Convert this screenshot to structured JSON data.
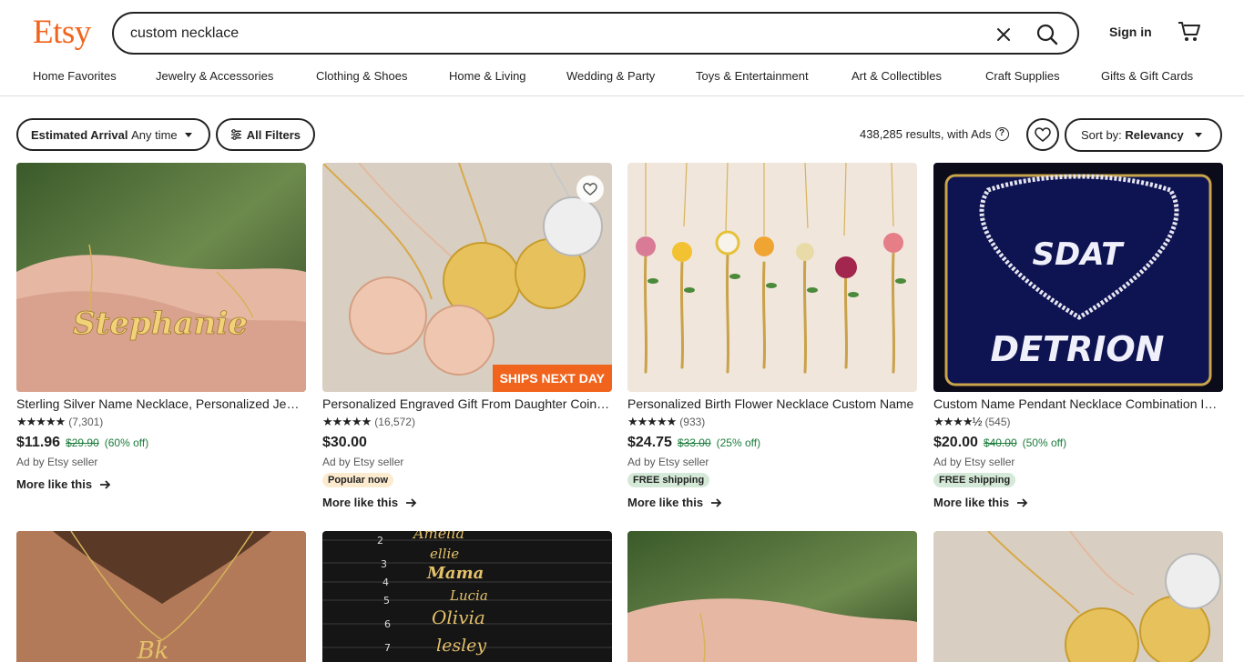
{
  "header": {
    "logo": "Etsy",
    "search_value": "custom necklace",
    "sign_in": "Sign in"
  },
  "nav": [
    "Home Favorites",
    "Jewelry & Accessories",
    "Clothing & Shoes",
    "Home & Living",
    "Wedding & Party",
    "Toys & Entertainment",
    "Art & Collectibles",
    "Craft Supplies",
    "Gifts & Gift Cards"
  ],
  "filters": {
    "arrival_label": "Estimated Arrival",
    "arrival_value": "Any time",
    "all_filters": "All Filters",
    "results": "438,285 results, with Ads",
    "sort_label": "Sort by:",
    "sort_value": "Relevancy"
  },
  "products": [
    {
      "title": "Sterling Silver Name Necklace, Personalized Jewelry",
      "reviews": "(7,301)",
      "price": "$11.96",
      "original": "$29.90",
      "discount": "(60% off)",
      "ad": "Ad by Etsy seller",
      "more": "More like this",
      "image": "Stephanie"
    },
    {
      "title": "Personalized Engraved Gift From Daughter Coin Necklace",
      "reviews": "(16,572)",
      "price": "$30.00",
      "ad": "Ad by Etsy seller",
      "badge": "Popular now",
      "more": "More like this",
      "ships_tag": "SHIPS NEXT DAY"
    },
    {
      "title": "Personalized Birth Flower Necklace Custom Name",
      "reviews": "(933)",
      "price": "$24.75",
      "original": "$33.00",
      "discount": "(25% off)",
      "ad": "Ad by Etsy seller",
      "badge": "FREE shipping",
      "more": "More like this"
    },
    {
      "title": "Custom Name Pendant Necklace Combination Iced Out",
      "reviews": "(545)",
      "price": "$20.00",
      "original": "$40.00",
      "discount": "(50% off)",
      "ad": "Ad by Etsy seller",
      "badge": "FREE shipping",
      "more": "More like this",
      "image_top": "SDAT",
      "image_bottom": "DETRION"
    }
  ],
  "row2_images": {
    "script_names": [
      "Amelia",
      "ellie",
      "Mama",
      "Lucia",
      "Olivia",
      "lesley"
    ],
    "numbers": [
      "2",
      "3",
      "4",
      "5",
      "6",
      "7"
    ]
  }
}
